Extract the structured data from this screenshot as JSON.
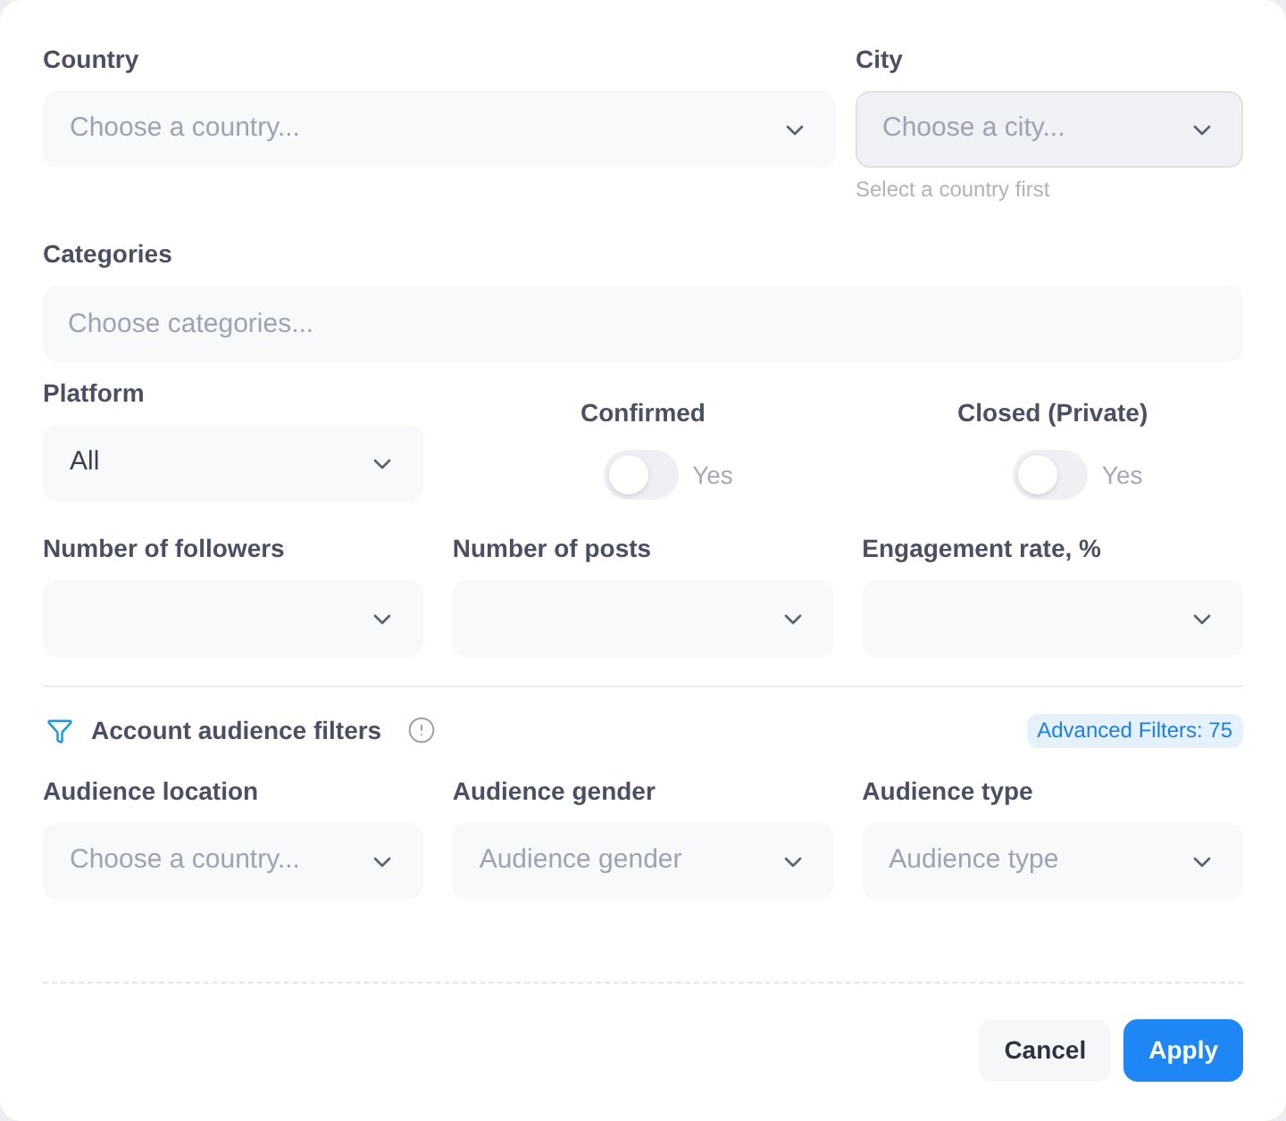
{
  "location": {
    "country": {
      "label": "Country",
      "placeholder": "Choose a country...",
      "disabled": false
    },
    "city": {
      "label": "City",
      "placeholder": "Choose a city...",
      "disabled": true,
      "hint": "Select a country first"
    }
  },
  "categories": {
    "label": "Categories",
    "placeholder": "Choose categories..."
  },
  "platform": {
    "label": "Platform",
    "value": "All"
  },
  "toggles": [
    {
      "label": "Confirmed",
      "option": "Yes",
      "on": false
    },
    {
      "label": "Closed (Private)",
      "option": "Yes",
      "on": false
    }
  ],
  "range_filters": [
    {
      "label": "Number of followers"
    },
    {
      "label": "Number of posts"
    },
    {
      "label": "Engagement rate, %"
    }
  ],
  "audience": {
    "title": "Account audience filters",
    "badge": "Advanced Filters: 75",
    "fields": [
      {
        "label": "Audience location",
        "placeholder": "Choose a country..."
      },
      {
        "label": "Audience gender",
        "placeholder": "Audience gender"
      },
      {
        "label": "Audience type",
        "placeholder": "Audience type"
      }
    ]
  },
  "buttons": [
    {
      "label": "Cancel",
      "kind": "secondary"
    },
    {
      "label": "Apply",
      "kind": "primary"
    }
  ]
}
